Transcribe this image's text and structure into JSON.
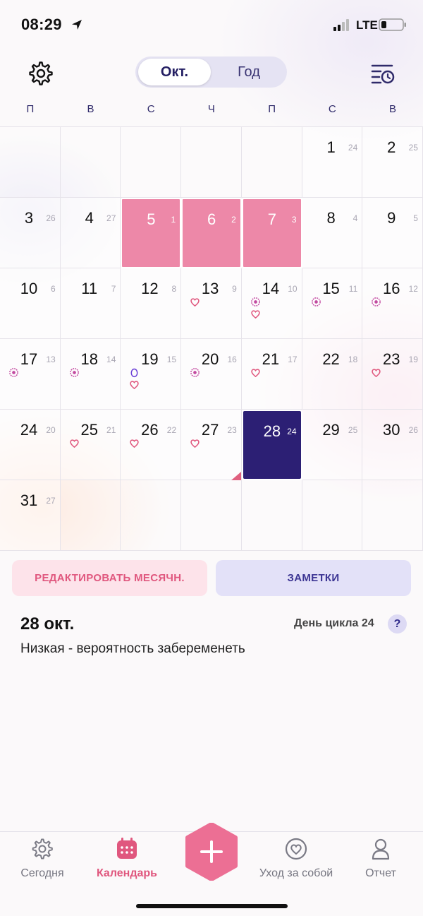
{
  "status_bar": {
    "time": "08:29",
    "network": "LTE"
  },
  "header": {
    "tab_month": "Окт.",
    "tab_year": "Год"
  },
  "weekdays": [
    "П",
    "В",
    "С",
    "Ч",
    "П",
    "С",
    "В"
  ],
  "calendar": {
    "month": "Окт.",
    "rows": [
      [
        null,
        null,
        null,
        null,
        null,
        {
          "d": "1",
          "c": "24"
        },
        {
          "d": "2",
          "c": "25"
        }
      ],
      [
        {
          "d": "3",
          "c": "26"
        },
        {
          "d": "4",
          "c": "27"
        },
        {
          "d": "5",
          "c": "1",
          "state": "period"
        },
        {
          "d": "6",
          "c": "2",
          "state": "period"
        },
        {
          "d": "7",
          "c": "3",
          "state": "period"
        },
        {
          "d": "8",
          "c": "4"
        },
        {
          "d": "9",
          "c": "5"
        }
      ],
      [
        {
          "d": "10",
          "c": "6"
        },
        {
          "d": "11",
          "c": "7"
        },
        {
          "d": "12",
          "c": "8"
        },
        {
          "d": "13",
          "c": "9",
          "marks": [
            "heart"
          ]
        },
        {
          "d": "14",
          "c": "10",
          "marks": [
            "flower",
            "heart"
          ]
        },
        {
          "d": "15",
          "c": "11",
          "marks": [
            "flower"
          ]
        },
        {
          "d": "16",
          "c": "12",
          "marks": [
            "flower"
          ]
        }
      ],
      [
        {
          "d": "17",
          "c": "13",
          "marks": [
            "flower"
          ]
        },
        {
          "d": "18",
          "c": "14",
          "marks": [
            "flower"
          ]
        },
        {
          "d": "19",
          "c": "15",
          "marks": [
            "egg",
            "heart"
          ]
        },
        {
          "d": "20",
          "c": "16",
          "marks": [
            "flower"
          ]
        },
        {
          "d": "21",
          "c": "17",
          "marks": [
            "heart"
          ]
        },
        {
          "d": "22",
          "c": "18"
        },
        {
          "d": "23",
          "c": "19",
          "marks": [
            "heart"
          ]
        }
      ],
      [
        {
          "d": "24",
          "c": "20"
        },
        {
          "d": "25",
          "c": "21",
          "marks": [
            "heart"
          ]
        },
        {
          "d": "26",
          "c": "22",
          "marks": [
            "heart"
          ]
        },
        {
          "d": "27",
          "c": "23",
          "marks": [
            "heart"
          ]
        },
        {
          "d": "28",
          "c": "24",
          "state": "today"
        },
        {
          "d": "29",
          "c": "25"
        },
        {
          "d": "30",
          "c": "26"
        }
      ],
      [
        {
          "d": "31",
          "c": "27"
        },
        null,
        null,
        null,
        null,
        null,
        null
      ]
    ]
  },
  "actions": {
    "edit_period": "РЕДАКТИРОВАТЬ МЕСЯЧН.",
    "notes": "ЗАМЕТКИ"
  },
  "info": {
    "selected_date": "28 окт.",
    "cycle_day": "День цикла 24",
    "help": "?",
    "fertility": "Низкая - вероятность забеременеть"
  },
  "tabbar": {
    "today": "Сегодня",
    "calendar": "Календарь",
    "selfcare": "Уход за собой",
    "report": "Отчет"
  },
  "colors": {
    "accent_pink": "#e0577e",
    "period": "#ed88a8",
    "today": "#2c1f74",
    "navy_text": "#2b2570"
  }
}
